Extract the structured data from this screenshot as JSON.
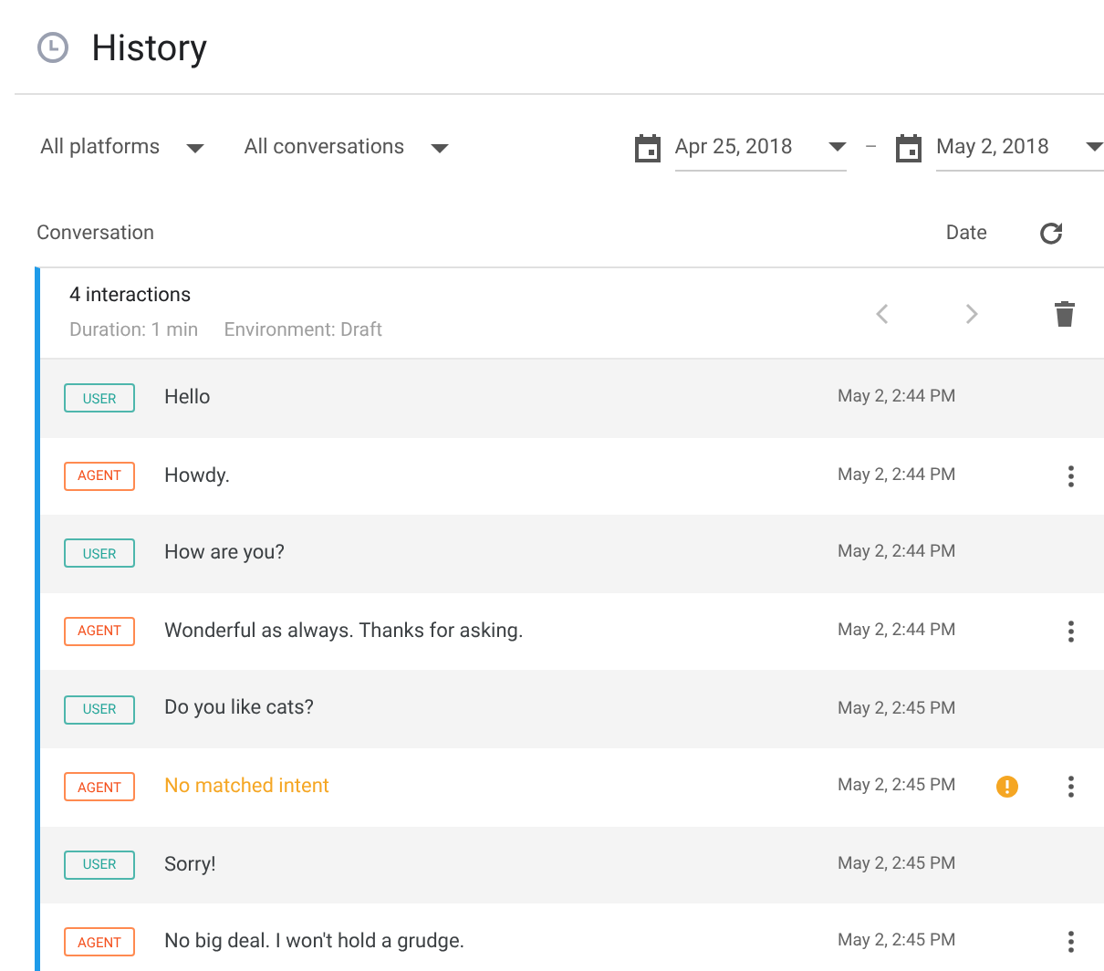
{
  "page": {
    "title": "History"
  },
  "filters": [
    {
      "label": "All platforms"
    },
    {
      "label": "All conversations"
    }
  ],
  "date_range": {
    "from": "Apr 25, 2018",
    "separator": "–",
    "to": "May 2, 2018"
  },
  "columns": {
    "conversation": "Conversation",
    "date": "Date"
  },
  "conversation": {
    "title": "4 interactions",
    "duration": "Duration: 1 min",
    "environment": "Environment: Draft",
    "messages": [
      {
        "kind": "user",
        "tag": "USER",
        "text": "Hello",
        "time": "May 2, 2:44 PM",
        "matched": true
      },
      {
        "kind": "agent",
        "tag": "AGENT",
        "text": "Howdy.",
        "time": "May 2, 2:44 PM",
        "matched": true
      },
      {
        "kind": "user",
        "tag": "USER",
        "text": "How are you?",
        "time": "May 2, 2:44 PM",
        "matched": true
      },
      {
        "kind": "agent",
        "tag": "AGENT",
        "text": "Wonderful as always. Thanks for asking.",
        "time": "May 2, 2:44 PM",
        "matched": true
      },
      {
        "kind": "user",
        "tag": "USER",
        "text": "Do you like cats?",
        "time": "May 2, 2:45 PM",
        "matched": true
      },
      {
        "kind": "agent",
        "tag": "AGENT",
        "text": "No matched intent",
        "time": "May 2, 2:45 PM",
        "matched": false
      },
      {
        "kind": "user",
        "tag": "USER",
        "text": "Sorry!",
        "time": "May 2, 2:45 PM",
        "matched": true
      },
      {
        "kind": "agent",
        "tag": "AGENT",
        "text": "No big deal. I won't hold a grudge.",
        "time": "May 2, 2:45 PM",
        "matched": true
      }
    ]
  }
}
